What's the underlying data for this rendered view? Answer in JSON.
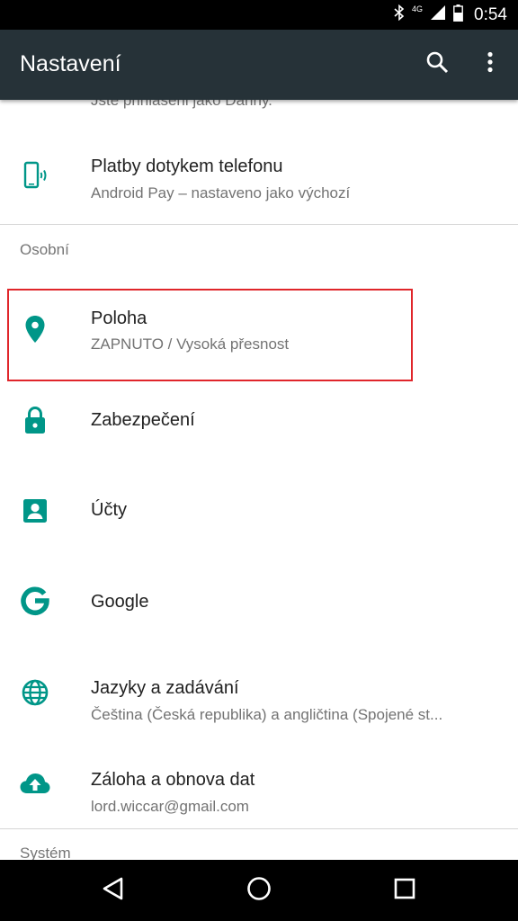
{
  "status_bar": {
    "time": "0:54",
    "network_label": "4G",
    "icons": [
      "bluetooth-icon",
      "signal-icon",
      "battery-icon"
    ]
  },
  "app_bar": {
    "title": "Nastavení",
    "actions": [
      "search-icon",
      "more-vert-icon"
    ]
  },
  "list": {
    "clipped_subtitle": "Jste přihlášeni jako Danny.",
    "items": [
      {
        "icon": "tap-pay-icon",
        "title": "Platby dotykem telefonu",
        "subtitle": "Android Pay – nastaveno jako výchozí"
      },
      {
        "icon": "location-pin-icon",
        "title": "Poloha",
        "subtitle": "ZAPNUTO / Vysoká přesnost"
      },
      {
        "icon": "lock-icon",
        "title": "Zabezpečení",
        "subtitle": ""
      },
      {
        "icon": "account-box-icon",
        "title": "Účty",
        "subtitle": ""
      },
      {
        "icon": "google-g-icon",
        "title": "Google",
        "subtitle": ""
      },
      {
        "icon": "globe-icon",
        "title": "Jazyky a zadávání",
        "subtitle": "Čeština (Česká republika) a angličtina (Spojené st..."
      },
      {
        "icon": "cloud-upload-icon",
        "title": "Záloha a obnova dat",
        "subtitle": "lord.wiccar@gmail.com"
      }
    ],
    "sections": {
      "personal": "Osobní",
      "system": "Systém"
    }
  },
  "nav_bar": {
    "buttons": [
      "back-icon",
      "home-icon",
      "recents-icon"
    ]
  },
  "colors": {
    "accent": "#009688",
    "app_bar": "#263238",
    "highlight": "#e0262b"
  }
}
